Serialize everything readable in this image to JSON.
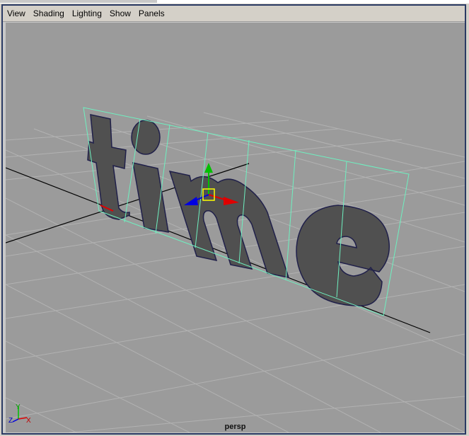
{
  "menu": {
    "items": [
      {
        "label": "View"
      },
      {
        "label": "Shading"
      },
      {
        "label": "Lighting"
      },
      {
        "label": "Show"
      },
      {
        "label": "Panels"
      }
    ]
  },
  "viewport": {
    "camera": "persp",
    "object_text": "time",
    "background": "#9b9b9b",
    "grid_color": "#b2b2b2",
    "mesh_color": "#505050",
    "wire_color": "#6ef0c0"
  },
  "axis_indicator": {
    "x_label": "X",
    "y_label": "Y",
    "z_label": "Z"
  }
}
